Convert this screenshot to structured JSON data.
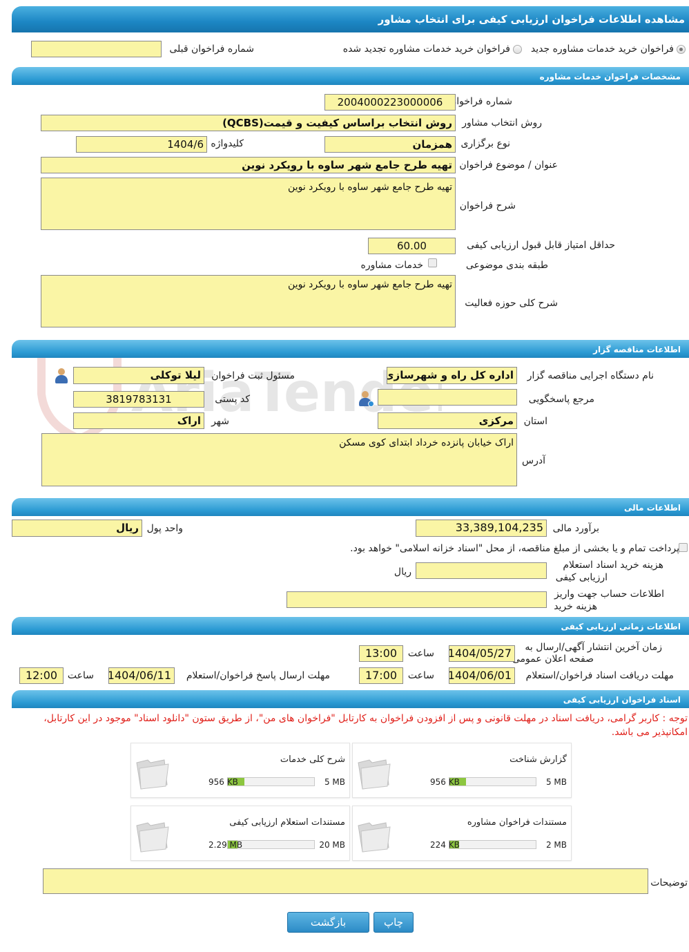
{
  "page_title": "مشاهده اطلاعات فراخوان ارزیابی کیفی برای انتخاب مشاور",
  "radios": {
    "new_label": "فراخوان خرید خدمات مشاوره جدید",
    "renewed_label": "فراخوان خرید خدمات مشاوره تجدید شده",
    "previous_number_label": "شماره فراخوان قبلی",
    "previous_number_value": ""
  },
  "section_specs": {
    "title": "مشخصات فراخوان خدمات مشاوره",
    "number_label": "شماره فراخوان",
    "number_value": "2004000223000006",
    "method_label": "روش انتخاب مشاور",
    "method_value": "روش انتخاب براساس کیفیت و قیمت(QCBS)",
    "type_label": "نوع برگزاری",
    "type_value": "همزمان",
    "keyword_label": "کلیدواژه",
    "keyword_value": "1404/6",
    "subject_label": "عنوان / موضوع فراخوان",
    "subject_value": "تهیه طرح جامع شهر ساوه با رویکرد نوین",
    "desc_label": "شرح فراخوان",
    "desc_value": "تهیه طرح جامع شهر ساوه با رویکرد نوین",
    "min_score_label": "حداقل امتیاز قابل قبول ارزیابی کیفی",
    "min_score_value": "60.00",
    "category_label": "طبقه بندی موضوعی",
    "category_value": "خدمات مشاوره",
    "scope_label": "شرح کلی حوزه فعالیت",
    "scope_value": "تهیه طرح جامع شهر ساوه با رویکرد نوین"
  },
  "section_org": {
    "title": "اطلاعات مناقصه گزار",
    "org_label": "نام دستگاه اجرایی مناقصه گزار",
    "org_value": "اداره کل راه و شهرسازی اس",
    "registrar_label": "مسئول ثبت فراخوان",
    "registrar_value": "لیلا توکلی",
    "responder_label": "مرجع پاسخگویی",
    "responder_value": "",
    "postal_label": "کد پستی",
    "postal_value": "3819783131",
    "province_label": "استان",
    "province_value": "مرکزی",
    "city_label": "شهر",
    "city_value": "اراک",
    "address_label": "آدرس",
    "address_value": "اراک خیابان پانزده خرداد ابتدای کوی مسکن"
  },
  "section_fin": {
    "title": "اطلاعات مالی",
    "budget_label": "برآورد مالی",
    "budget_value": "33,389,104,235",
    "currency_label": "واحد پول",
    "currency_value": "ریال",
    "treasury_text": "پرداخت تمام و یا بخشی از مبلغ مناقصه، از محل \"اسناد خزانه اسلامی\" خواهد بود.",
    "doc_cost_label_1": "هزینه خرید اسناد استعلام",
    "doc_cost_label_2": "ارزیابی کیفی",
    "doc_cost_value": "",
    "doc_cost_unit": "ریال",
    "account_label_1": "اطلاعات حساب جهت واریز",
    "account_label_2": "هزینه خرید",
    "account_value": ""
  },
  "section_time": {
    "title": "اطلاعات زمانی ارزیابی کیفی",
    "publish_label_1": "زمان آخرین انتشار آگهی/ارسال به",
    "publish_label_2": "صفحه اعلان عمومی",
    "publish_date": "1404/05/27",
    "time_label": "ساعت",
    "publish_time": "13:00",
    "receive_label": "مهلت دریافت اسناد فراخوان/استعلام",
    "receive_date": "1404/06/01",
    "receive_time": "17:00",
    "reply_label": "مهلت ارسال پاسخ فراخوان/استعلام",
    "reply_date": "1404/06/11",
    "reply_time": "12:00"
  },
  "section_docs": {
    "title": "اسناد فراخوان ارزیابی کیفی",
    "notice_1": "توجه : کاربر گرامی، دریافت اسناد در مهلت قانونی و پس از افزودن فراخوان به کارتابل \"فراخوان های من\"، از طریق ستون \"دانلود اسناد\" موجود در این کارتابل،",
    "notice_2": "امکانپذیر می باشد.",
    "files": [
      {
        "title": "گزارش شناخت",
        "max": "5 MB",
        "size": "956 KB",
        "fill": 0.19
      },
      {
        "title": "شرح کلی خدمات",
        "max": "5 MB",
        "size": "956 KB",
        "fill": 0.19
      },
      {
        "title": "مستندات فراخوان مشاوره",
        "max": "2 MB",
        "size": "224 KB",
        "fill": 0.11
      },
      {
        "title": "مستندات استعلام ارزیابی کیفی",
        "max": "20 MB",
        "size": "2.29 MB",
        "fill": 0.11
      }
    ],
    "notes_label": "توضیحات",
    "notes_value": ""
  },
  "buttons": {
    "print": "چاپ",
    "back": "بازگشت"
  },
  "watermark": "AriaTender.neT",
  "colors": {
    "header_blue": "#1c86c4",
    "field_yellow": "#faf5a5",
    "progress_green": "#8cc63f",
    "notice_red": "#e0201a"
  }
}
